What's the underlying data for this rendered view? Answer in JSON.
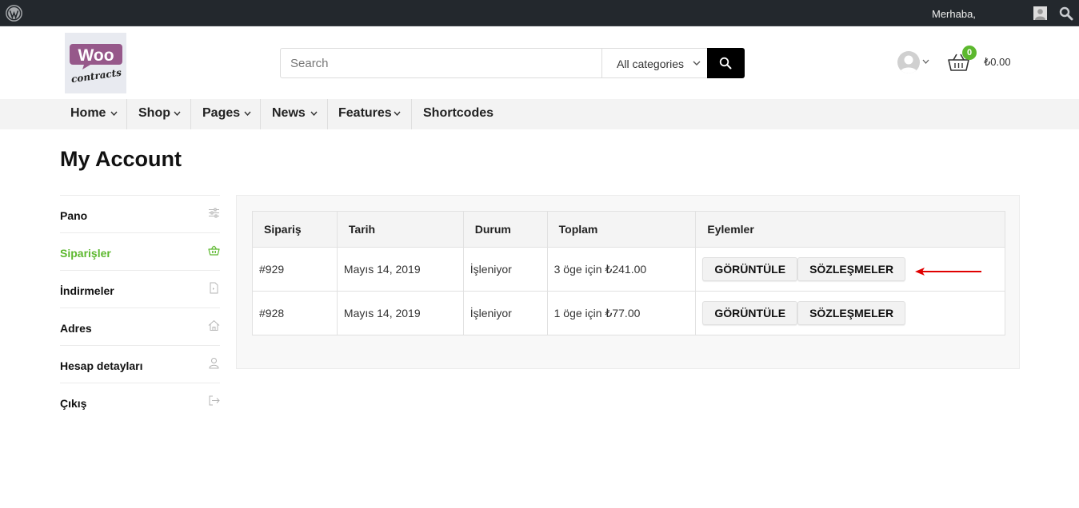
{
  "admin_bar": {
    "greeting": "Merhaba,"
  },
  "header": {
    "logo": {
      "line1": "Woo",
      "line2": "contracts"
    },
    "search": {
      "placeholder": "Search",
      "category": "All categories"
    },
    "cart": {
      "count": "0",
      "total": "₺0.00"
    }
  },
  "nav": {
    "items": [
      "Home",
      "Shop",
      "Pages",
      "News",
      "Features",
      "Shortcodes"
    ]
  },
  "page": {
    "title": "My Account"
  },
  "sidebar": {
    "items": [
      {
        "label": "Pano",
        "icon": "sliders-icon"
      },
      {
        "label": "Siparişler",
        "icon": "basket-icon",
        "active": true
      },
      {
        "label": "İndirmeler",
        "icon": "file-download-icon"
      },
      {
        "label": "Adres",
        "icon": "home-icon"
      },
      {
        "label": "Hesap detayları",
        "icon": "user-icon"
      },
      {
        "label": "Çıkış",
        "icon": "logout-icon"
      }
    ]
  },
  "orders": {
    "columns": [
      "Sipariş",
      "Tarih",
      "Durum",
      "Toplam",
      "Eylemler"
    ],
    "rows": [
      {
        "number": "#929",
        "date": "Mayıs 14, 2019",
        "status": "İşleniyor",
        "total": "3 öge için ₺241.00",
        "actions": [
          "GÖRÜNTÜLE",
          "SÖZLEŞMELER"
        ]
      },
      {
        "number": "#928",
        "date": "Mayıs 14, 2019",
        "status": "İşleniyor",
        "total": "1 öge için ₺77.00",
        "actions": [
          "GÖRÜNTÜLE",
          "SÖZLEŞMELER"
        ]
      }
    ]
  },
  "colors": {
    "accent_green": "#5cb82e",
    "admin_bar": "#23282d",
    "logo_purple": "#96588a",
    "annotation_arrow": "#e00000"
  }
}
